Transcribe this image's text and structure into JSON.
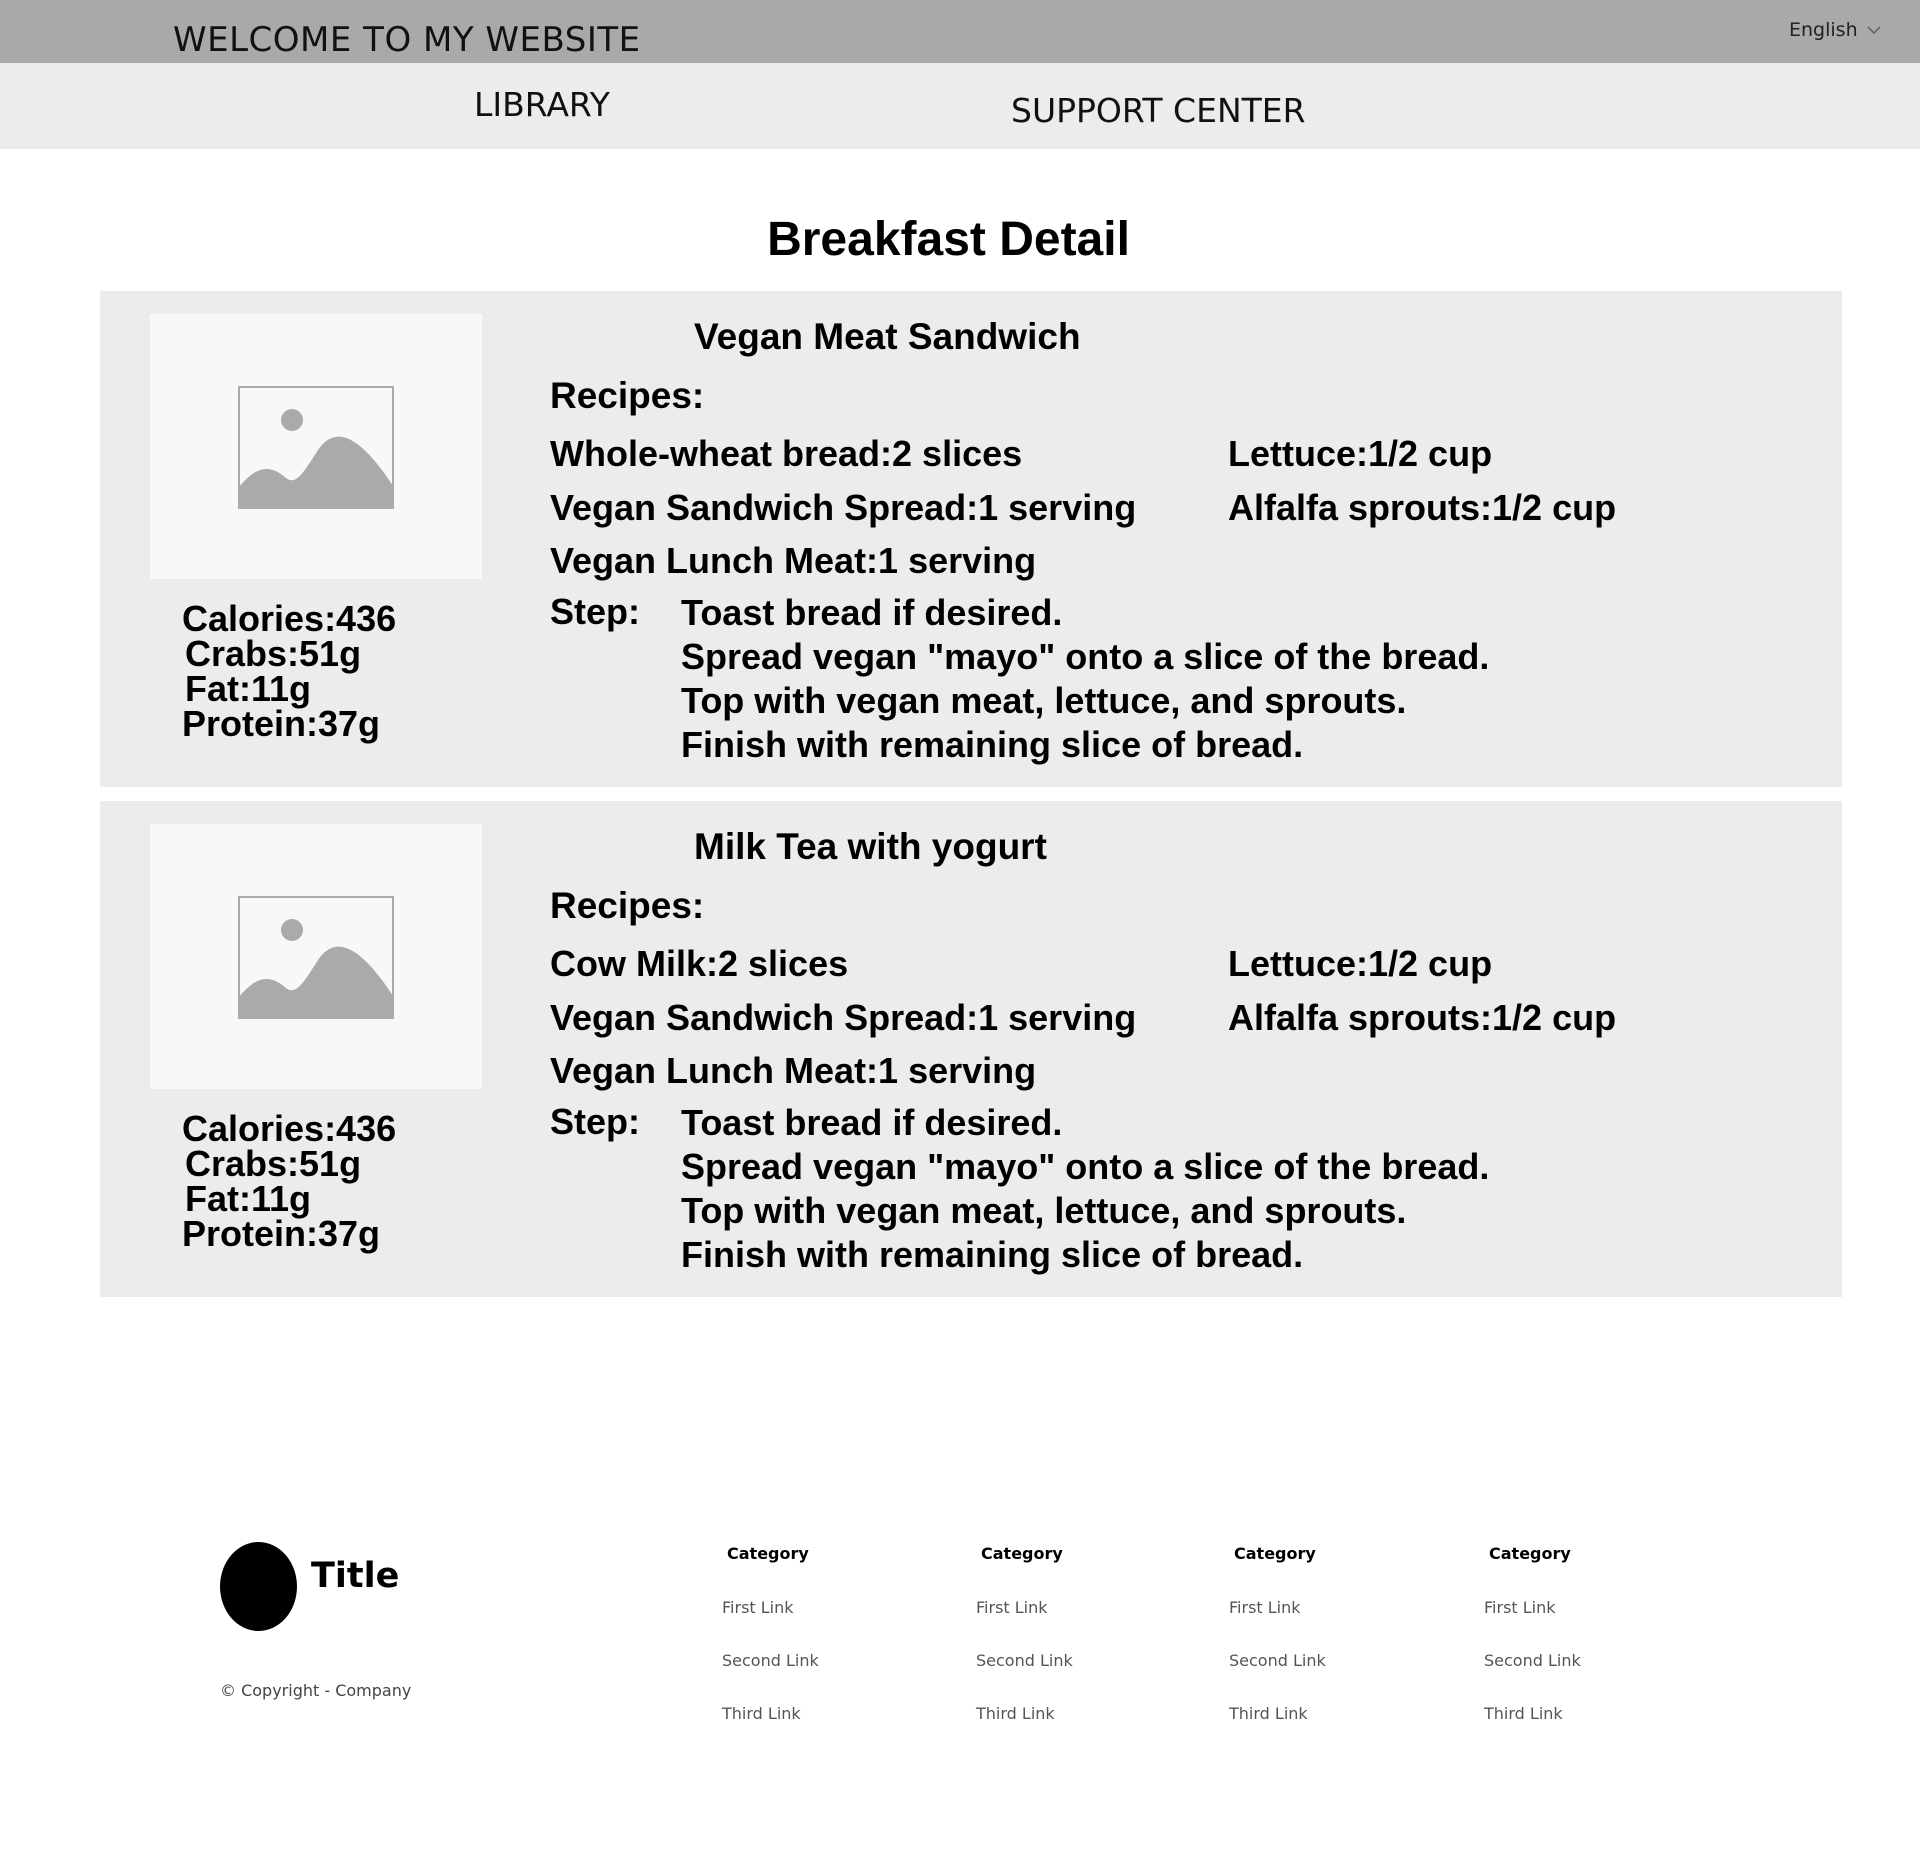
{
  "header": {
    "site_title": "WELCOME TO MY WEBSITE",
    "language": "English"
  },
  "nav": {
    "items": [
      {
        "label": "LIBRARY"
      },
      {
        "label": "SUPPORT CENTER"
      }
    ]
  },
  "page": {
    "title": "Breakfast Detail"
  },
  "meals": [
    {
      "name": "Vegan Meat Sandwich",
      "recipes_label": "Recipes:",
      "ingredients_col1": [
        "Whole-wheat bread:2 slices",
        "Vegan Sandwich Spread:1 serving",
        "Vegan Lunch Meat:1 serving"
      ],
      "ingredients_col2": [
        "Lettuce:1/2 cup",
        "Alfalfa sprouts:1/2 cup"
      ],
      "step_label": "Step:",
      "steps": [
        "Toast bread if desired.",
        "Spread vegan \"mayo\" onto a slice of the bread.",
        "Top with vegan meat, lettuce, and sprouts.",
        "Finish with remaining slice of bread."
      ],
      "nutrition": {
        "calories": "Calories:436",
        "carbs": "Crabs:51g",
        "fat": "Fat:11g",
        "protein": "Protein:37g"
      }
    },
    {
      "name": "Milk Tea with yogurt",
      "recipes_label": "Recipes:",
      "ingredients_col1": [
        "Cow Milk:2 slices",
        "Vegan Sandwich Spread:1 serving",
        "Vegan Lunch Meat:1 serving"
      ],
      "ingredients_col2": [
        "Lettuce:1/2 cup",
        "Alfalfa sprouts:1/2 cup"
      ],
      "step_label": "Step:",
      "steps": [
        "Toast bread if desired.",
        "Spread vegan \"mayo\" onto a slice of the bread.",
        "Top with vegan meat, lettuce, and sprouts.",
        "Finish with remaining slice of bread."
      ],
      "nutrition": {
        "calories": "Calories:436",
        "carbs": "Crabs:51g",
        "fat": "Fat:11g",
        "protein": "Protein:37g"
      }
    }
  ],
  "footer": {
    "title": "Title",
    "copyright": "© Copyright - Company",
    "columns": [
      {
        "category": "Category",
        "links": [
          "First Link",
          "Second Link",
          "Third Link"
        ]
      },
      {
        "category": "Category",
        "links": [
          "First Link",
          "Second Link",
          "Third Link"
        ]
      },
      {
        "category": "Category",
        "links": [
          "First Link",
          "Second Link",
          "Third Link"
        ]
      },
      {
        "category": "Category",
        "links": [
          "First Link",
          "Second Link",
          "Third Link"
        ]
      }
    ]
  },
  "colors": {
    "topbar": "#a9a9a9",
    "navbar": "#ececec",
    "card": "#ececec",
    "image_bg": "#f8f8f8",
    "placeholder_icon": "#aaaaaa"
  }
}
